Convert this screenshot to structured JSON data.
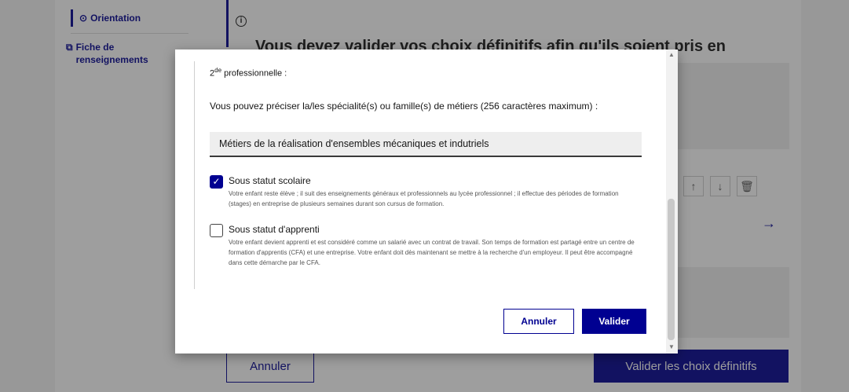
{
  "background": {
    "nav": {
      "orientation_label": "Orientation",
      "fiche_label": "Fiche de renseignements"
    },
    "title": "Vous devez valider vos choix définitifs afin qu'ils soient pris en",
    "cancel_label": "Annuler",
    "submit_label": "Valider les choix définitifs"
  },
  "modal": {
    "level_prefix": "2",
    "level_sup": "de",
    "level_suffix": " professionnelle :",
    "prompt": "Vous pouvez préciser la/les spécialité(s) ou famille(s) de métiers (256 caractères maximum) :",
    "input_value": "Métiers de la réalisation d'ensembles mécaniques et indutriels",
    "options": [
      {
        "title": "Sous statut scolaire",
        "checked": true,
        "description": "Votre enfant reste élève ; il suit des enseignements généraux et professionnels au lycée professionnel ; il effectue des périodes de formation (stages) en entreprise de plusieurs semaines durant son cursus de formation."
      },
      {
        "title": "Sous statut d'apprenti",
        "checked": false,
        "description": "Votre enfant devient apprenti et est considéré comme un salarié avec un contrat de travail. Son temps de formation est partagé entre un centre de formation d'apprentis (CFA) et une entreprise. Votre enfant doit dès maintenant se mettre à la recherche d'un employeur. Il peut être accompagné dans cette démarche par le CFA."
      }
    ],
    "cancel_label": "Annuler",
    "submit_label": "Valider"
  },
  "icons": {
    "info": "info-icon",
    "arrow_up": "↑",
    "arrow_down": "↓",
    "trash": "🗑",
    "arrow_right": "→",
    "check": "✓"
  },
  "colors": {
    "primary": "#000091",
    "overlay": "rgba(40,40,40,0.45)"
  }
}
